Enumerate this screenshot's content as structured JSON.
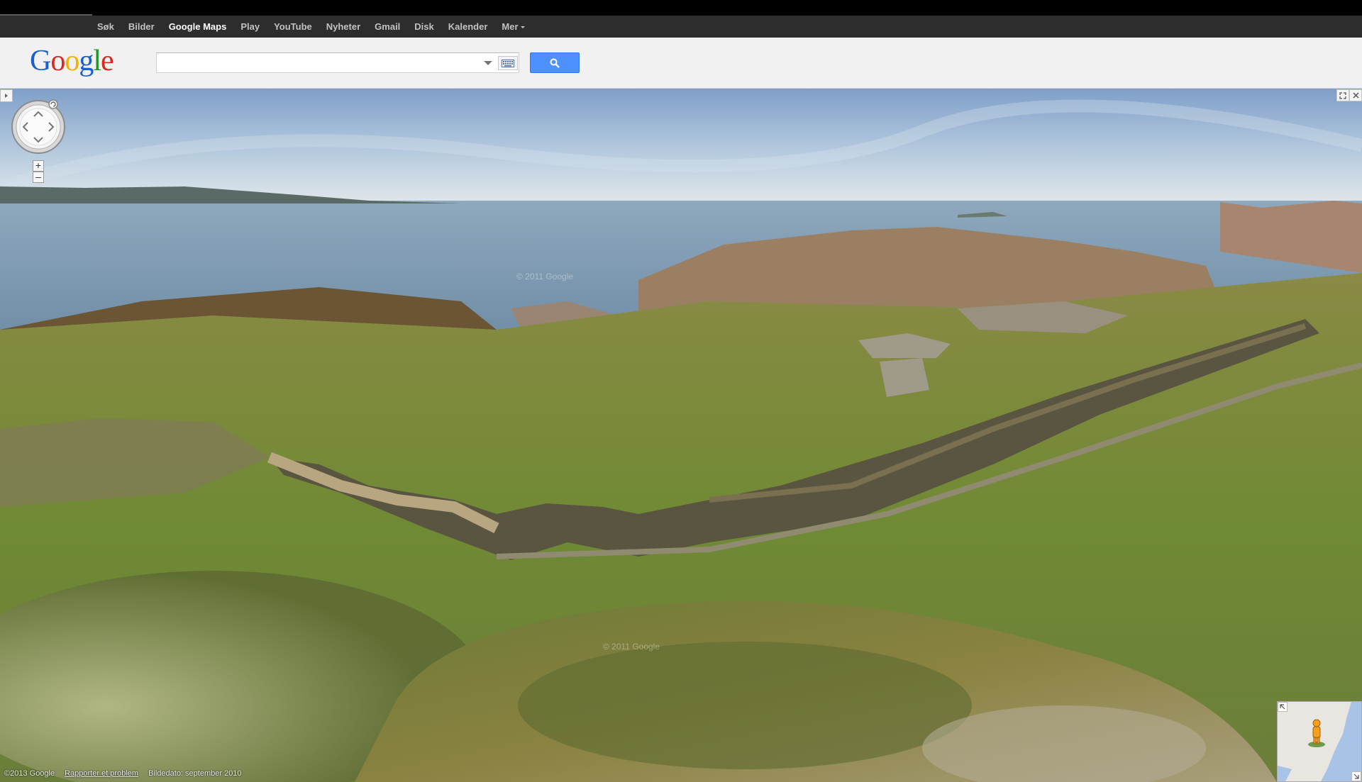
{
  "nav": {
    "items": [
      {
        "label": "Søk",
        "active": false
      },
      {
        "label": "Bilder",
        "active": false
      },
      {
        "label": "Google Maps",
        "active": true
      },
      {
        "label": "Play",
        "active": false
      },
      {
        "label": "YouTube",
        "active": false
      },
      {
        "label": "Nyheter",
        "active": false
      },
      {
        "label": "Gmail",
        "active": false
      },
      {
        "label": "Disk",
        "active": false
      },
      {
        "label": "Kalender",
        "active": false
      }
    ],
    "more_label": "Mer"
  },
  "logo": {
    "letters": [
      "G",
      "o",
      "o",
      "g",
      "l",
      "e"
    ]
  },
  "search": {
    "value": "",
    "placeholder": ""
  },
  "panorama": {
    "watermark": "© 2011 Google"
  },
  "footer": {
    "copyright": "©2013 Google",
    "report_link": "Rapporter et problem",
    "image_date": "Bildedato: september 2010"
  },
  "colors": {
    "navbar": "#2d2d2d",
    "header": "#f1f1f1",
    "search_button": "#4d90fe",
    "sea": "#6f8ea6",
    "grass": "#7c8a3a"
  }
}
